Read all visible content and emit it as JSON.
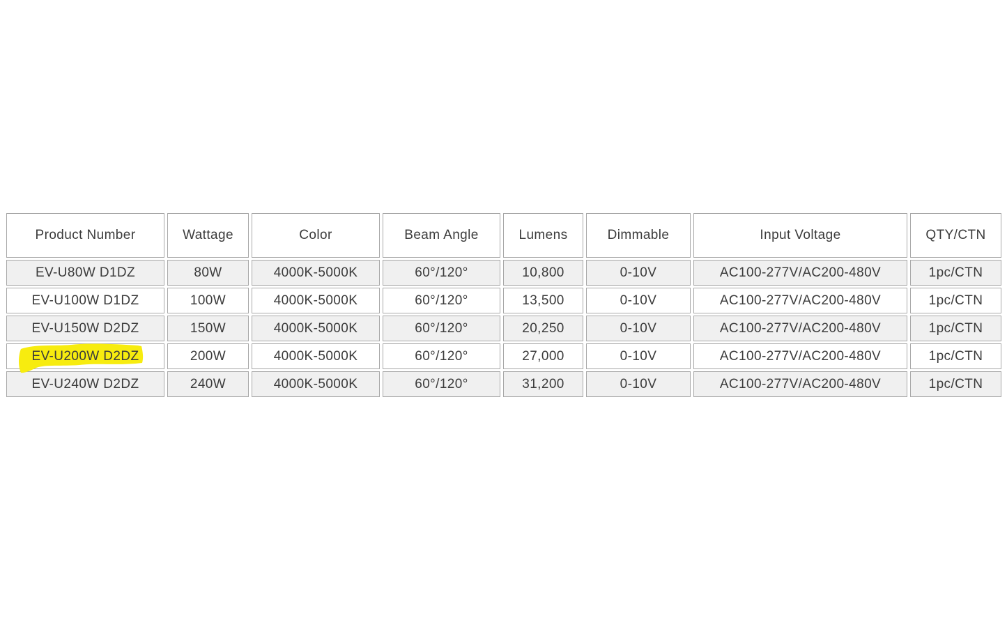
{
  "page": {
    "background": "#ffffff",
    "description": "Product specification sheet table with one product number marked by a yellow highlighter stroke"
  },
  "colors": {
    "text": "#3b3b3b",
    "border": "#a8a8a8",
    "stripe_row_bg": "#f0f0f0",
    "row_bg": "#ffffff",
    "highlight": "#f7ec0f"
  },
  "table": {
    "headers": [
      "Product Number",
      "Wattage",
      "Color",
      "Beam Angle",
      "Lumens",
      "Dimmable",
      "Input Voltage",
      "QTY/CTN"
    ],
    "rows": [
      [
        "EV-U80W D1DZ",
        "80W",
        "4000K-5000K",
        "60°/120°",
        "10,800",
        "0-10V",
        "AC100-277V/AC200-480V",
        "1pc/CTN"
      ],
      [
        "EV-U100W D1DZ",
        "100W",
        "4000K-5000K",
        "60°/120°",
        "13,500",
        "0-10V",
        "AC100-277V/AC200-480V",
        "1pc/CTN"
      ],
      [
        "EV-U150W D2DZ",
        "150W",
        "4000K-5000K",
        "60°/120°",
        "20,250",
        "0-10V",
        "AC100-277V/AC200-480V",
        "1pc/CTN"
      ],
      [
        "EV-U200W D2DZ",
        "200W",
        "4000K-5000K",
        "60°/120°",
        "27,000",
        "0-10V",
        "AC100-277V/AC200-480V",
        "1pc/CTN"
      ],
      [
        "EV-U240W D2DZ",
        "240W",
        "4000K-5000K",
        "60°/120°",
        "31,200",
        "0-10V",
        "AC100-277V/AC200-480V",
        "1pc/CTN"
      ]
    ],
    "highlight": {
      "row_index": 3,
      "column_index": 0,
      "highlighted_text": "EV-U200W D2DZ",
      "color": "#f7ec0f",
      "style": "hand-drawn highlighter stroke"
    }
  }
}
